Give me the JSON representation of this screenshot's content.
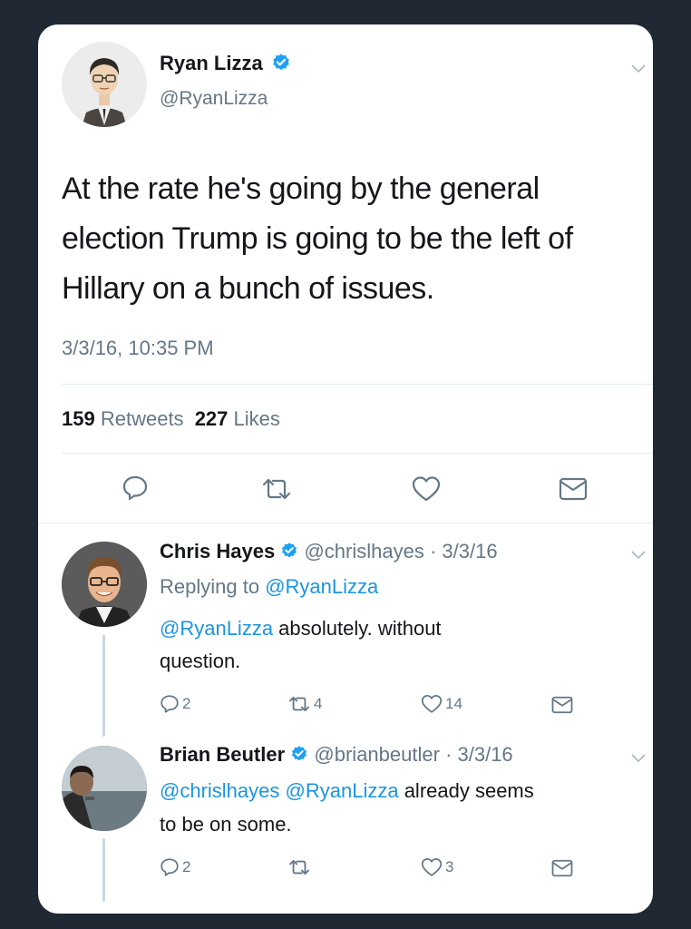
{
  "main_tweet": {
    "author_name": "Ryan Lizza",
    "author_handle": "@RyanLizza",
    "text_lines": [
      "At the rate he's going by the general",
      "election Trump is going to be the left of",
      "Hillary on a bunch of issues."
    ],
    "timestamp": "3/3/16, 10:35 PM",
    "retweets_count": "159",
    "retweets_label": "Retweets",
    "likes_count": "227",
    "likes_label": "Likes"
  },
  "replies": [
    {
      "author_name": "Chris Hayes",
      "author_handle": "@chrislhayes",
      "date": "· 3/3/16",
      "replying_prefix": "Replying to",
      "replying_handle": "@RyanLizza",
      "mention": "@RyanLizza",
      "text_line1_rest": " absolutely. without",
      "text_line2": "question.",
      "reply_count": "2",
      "retweet_count": "4",
      "like_count": "14"
    },
    {
      "author_name": "Brian Beutler",
      "author_handle": "@brianbeutler",
      "date": "· 3/3/16",
      "mention1": "@chrislhayes",
      "mention2": "@RyanLizza",
      "text_line1_rest": " already seems",
      "text_line2": "to be on some.",
      "reply_count": "2",
      "like_count": "3"
    }
  ],
  "colors": {
    "background": "#1f2833",
    "card": "#ffffff",
    "link": "#1b95e0",
    "verified": "#1da1f2",
    "secondary_text": "#657786",
    "primary_text": "#14171a"
  },
  "icons": [
    "verified-badge-icon",
    "chevron-down-icon",
    "reply-icon",
    "retweet-icon",
    "like-icon",
    "message-icon"
  ]
}
